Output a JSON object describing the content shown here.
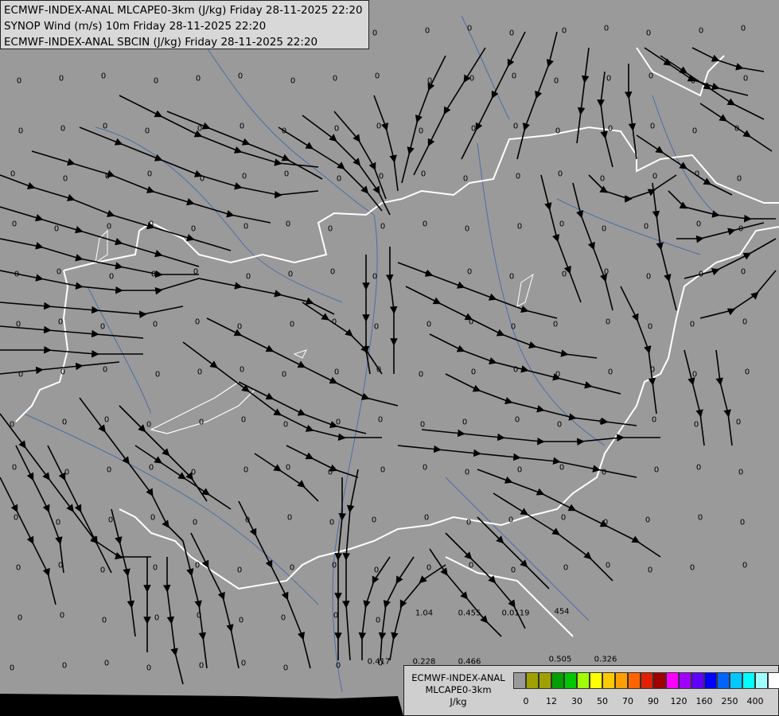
{
  "title_lines": [
    "ECMWF-INDEX-ANAL MLCAPE0-3km (J/kg) Friday 28-11-2025 22:20",
    "SYNOP Wind (m/s) 10m Friday 28-11-2025 22:20",
    "ECMWF-INDEX-ANAL SBCIN (J/kg) Friday 28-11-2025 22:20"
  ],
  "legend": {
    "title_lines": [
      "ECMWF-INDEX-ANAL",
      "MLCAPE0-3km",
      "J/kg"
    ],
    "colors": [
      "#9a9a9a",
      "#a0a000",
      "#a0a000",
      "#00a000",
      "#00c800",
      "#a0ff00",
      "#ffff00",
      "#ffc800",
      "#ffa000",
      "#ff6400",
      "#e02000",
      "#a00000",
      "#ff00ff",
      "#a000ff",
      "#6000ff",
      "#0000ff",
      "#0064ff",
      "#00c8ff",
      "#00ffff",
      "#a0ffff",
      "#ffffff"
    ],
    "ticks": [
      "0",
      "12",
      "30",
      "50",
      "70",
      "90",
      "120",
      "160",
      "250",
      "400"
    ]
  },
  "labeled_values": [
    "1.04",
    "0.455",
    "0.0119",
    "454",
    "0.417",
    "0.228",
    "0.466",
    "0.505",
    "0.326"
  ]
}
